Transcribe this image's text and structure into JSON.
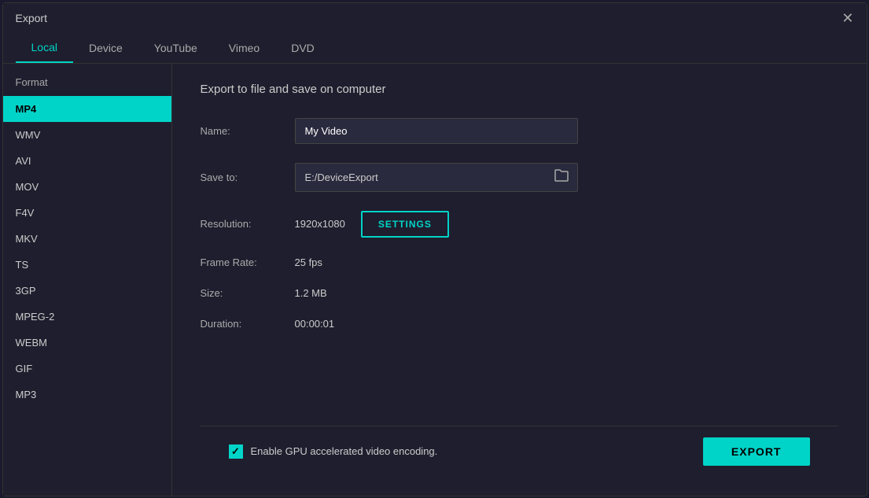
{
  "dialog": {
    "title": "Export"
  },
  "tabs": [
    {
      "id": "local",
      "label": "Local",
      "active": true
    },
    {
      "id": "device",
      "label": "Device",
      "active": false
    },
    {
      "id": "youtube",
      "label": "YouTube",
      "active": false
    },
    {
      "id": "vimeo",
      "label": "Vimeo",
      "active": false
    },
    {
      "id": "dvd",
      "label": "DVD",
      "active": false
    }
  ],
  "sidebar": {
    "header": "Format",
    "items": [
      {
        "id": "mp4",
        "label": "MP4",
        "active": true
      },
      {
        "id": "wmv",
        "label": "WMV",
        "active": false
      },
      {
        "id": "avi",
        "label": "AVI",
        "active": false
      },
      {
        "id": "mov",
        "label": "MOV",
        "active": false
      },
      {
        "id": "f4v",
        "label": "F4V",
        "active": false
      },
      {
        "id": "mkv",
        "label": "MKV",
        "active": false
      },
      {
        "id": "ts",
        "label": "TS",
        "active": false
      },
      {
        "id": "3gp",
        "label": "3GP",
        "active": false
      },
      {
        "id": "mpeg2",
        "label": "MPEG-2",
        "active": false
      },
      {
        "id": "webm",
        "label": "WEBM",
        "active": false
      },
      {
        "id": "gif",
        "label": "GIF",
        "active": false
      },
      {
        "id": "mp3",
        "label": "MP3",
        "active": false
      }
    ]
  },
  "main": {
    "title": "Export to file and save on computer",
    "name_label": "Name:",
    "name_value": "My Video",
    "save_to_label": "Save to:",
    "save_to_value": "E:/DeviceExport",
    "resolution_label": "Resolution:",
    "resolution_value": "1920x1080",
    "settings_btn_label": "SETTINGS",
    "frame_rate_label": "Frame Rate:",
    "frame_rate_value": "25 fps",
    "size_label": "Size:",
    "size_value": "1.2 MB",
    "duration_label": "Duration:",
    "duration_value": "00:00:01"
  },
  "bottom": {
    "gpu_label": "Enable GPU accelerated video encoding.",
    "export_label": "EXPORT"
  },
  "icons": {
    "close": "✕",
    "folder": "🗀"
  }
}
